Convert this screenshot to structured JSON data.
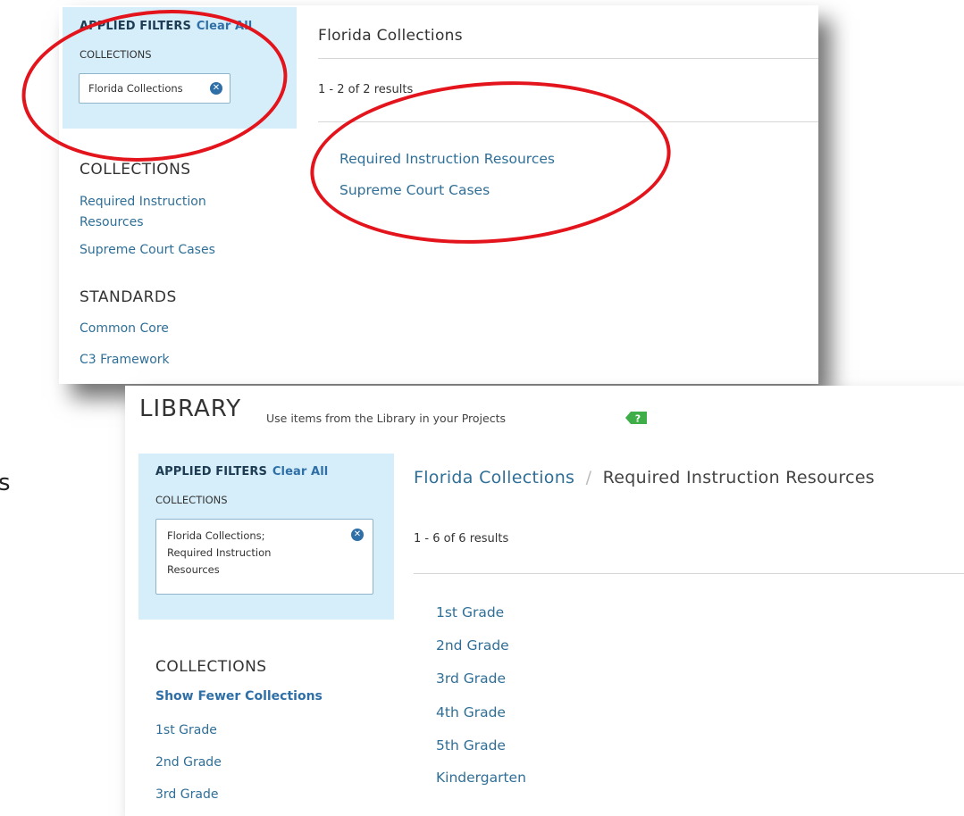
{
  "top_panel": {
    "applied_filters_label": "APPLIED FILTERS",
    "clear_all_label": "Clear All",
    "filter_group_label": "COLLECTIONS",
    "filter_chip_label": "Florida Collections",
    "page_title": "Florida Collections",
    "results_count": "1 - 2 of 2 results",
    "results": [
      "Required Instruction Resources",
      "Supreme Court Cases"
    ],
    "collections_heading": "COLLECTIONS",
    "collections_links": [
      "Required Instruction Resources",
      "Supreme Court Cases"
    ],
    "standards_heading": "STANDARDS",
    "standards_links": [
      "Common Core",
      "C3 Framework"
    ]
  },
  "bottom_panel": {
    "library_title": "LIBRARY",
    "library_subtitle": "Use items from the Library in your Projects",
    "help_icon_glyph": "?",
    "applied_filters_label": "APPLIED FILTERS",
    "clear_all_label": "Clear All",
    "filter_group_label": "COLLECTIONS",
    "filter_chip_lines": [
      "Florida Collections;",
      "Required Instruction",
      "Resources"
    ],
    "breadcrumb": {
      "parent": "Florida Collections",
      "separator": "/",
      "current": "Required Instruction Resources"
    },
    "results_count": "1 - 6 of 6 results",
    "results": [
      "1st Grade",
      "2nd Grade",
      "3rd Grade",
      "4th Grade",
      "5th Grade",
      "Kindergarten"
    ],
    "collections_heading": "COLLECTIONS",
    "show_fewer_label": "Show Fewer Collections",
    "collections_links": [
      "1st Grade",
      "2nd Grade",
      "3rd Grade"
    ]
  },
  "edge_fragment": "s",
  "colors": {
    "annotation": "#e3141c",
    "filter_panel": "#d6eefa",
    "link": "#2f6f97",
    "help_icon": "#3fae49"
  }
}
